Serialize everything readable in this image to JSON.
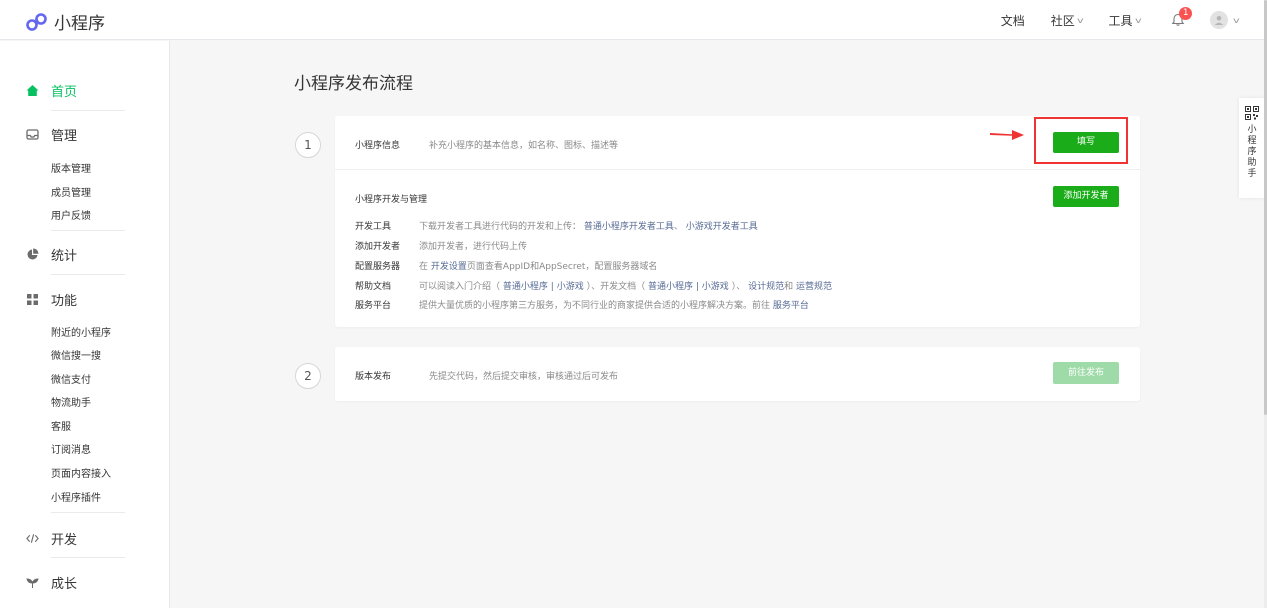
{
  "app": {
    "name": "小程序",
    "brand_color": "#07c160"
  },
  "topnav": {
    "docs": "文档",
    "community": "社区",
    "tools": "工具",
    "notification_count": "1"
  },
  "sidebar": {
    "home": "首页",
    "manage": {
      "label": "管理",
      "items": [
        "版本管理",
        "成员管理",
        "用户反馈"
      ]
    },
    "stats": "统计",
    "features": {
      "label": "功能",
      "items": [
        "附近的小程序",
        "微信搜一搜",
        "微信支付",
        "物流助手",
        "客服",
        "订阅消息",
        "页面内容接入",
        "小程序插件"
      ]
    },
    "develop": "开发",
    "growth": "成长"
  },
  "main": {
    "title": "小程序发布流程",
    "step1": {
      "number": "1",
      "info_label": "小程序信息",
      "info_desc": "补充小程序的基本信息，如名称、图标、描述等",
      "fill_button": "填写",
      "dev_title": "小程序开发与管理",
      "add_dev_button": "添加开发者",
      "rows": {
        "devtool": {
          "label": "开发工具",
          "text": "下载开发者工具进行代码的开发和上传：",
          "link1": "普通小程序开发者工具",
          "sep": "、",
          "link2": "小游戏开发者工具"
        },
        "adddev": {
          "label": "添加开发者",
          "text": "添加开发者，进行代码上传"
        },
        "server": {
          "label": "配置服务器",
          "pre": "在",
          "link": "开发设置",
          "post": "页面查看AppID和AppSecret，配置服务器域名"
        },
        "help": {
          "label": "帮助文档",
          "t1": "可以阅读入门介绍（",
          "l1": "普通小程序",
          "bar1": "|",
          "l2": "小游戏",
          "t2": "）、开发文档（",
          "l3": "普通小程序",
          "bar2": "|",
          "l4": "小游戏",
          "t3": "）、",
          "l5": "设计规范",
          "t4": "和",
          "l6": "运营规范"
        },
        "platform": {
          "label": "服务平台",
          "text": "提供大量优质的小程序第三方服务，为不同行业的商家提供合适的小程序解决方案。前往",
          "link": "服务平台"
        }
      }
    },
    "step2": {
      "number": "2",
      "label": "版本发布",
      "desc": "先提交代码，然后提交审核，审核通过后可发布",
      "button": "前往发布"
    }
  },
  "side_tab": {
    "label": "小程序助手"
  },
  "colors": {
    "primary_button": "#1aad19",
    "disabled_button": "#9fdba8",
    "link": "#576b95",
    "highlight_border": "#f03434",
    "badge": "#fa5151"
  }
}
